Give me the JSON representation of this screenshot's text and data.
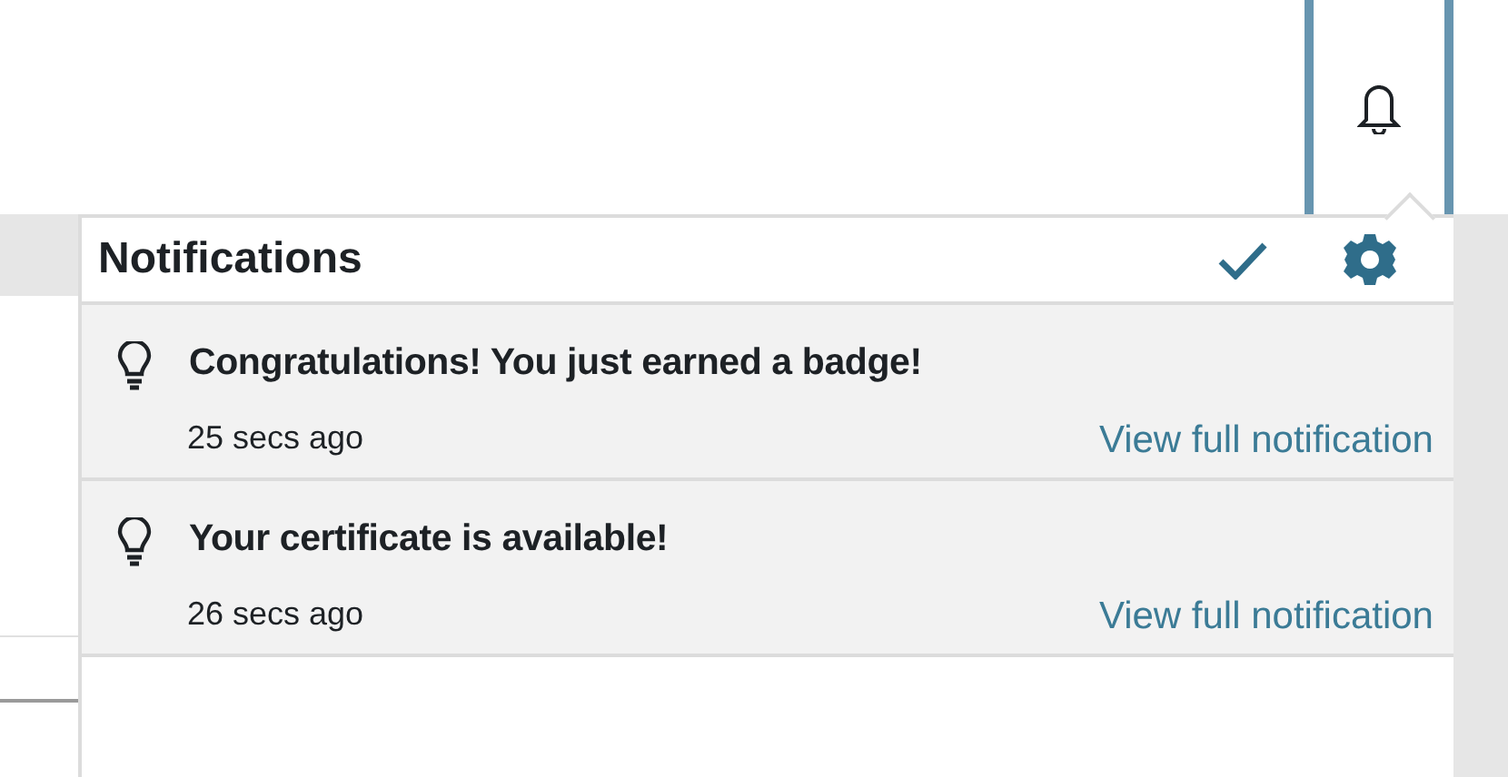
{
  "navbar": {
    "bell": {
      "active": true
    }
  },
  "popover": {
    "title": "Notifications",
    "items": [
      {
        "unread": true,
        "message": "Congratulations! You just earned a badge!",
        "time": "25 secs ago",
        "link": "View full notification"
      },
      {
        "unread": true,
        "message": "Your certificate is available!",
        "time": "26 secs ago",
        "link": "View full notification"
      }
    ]
  }
}
